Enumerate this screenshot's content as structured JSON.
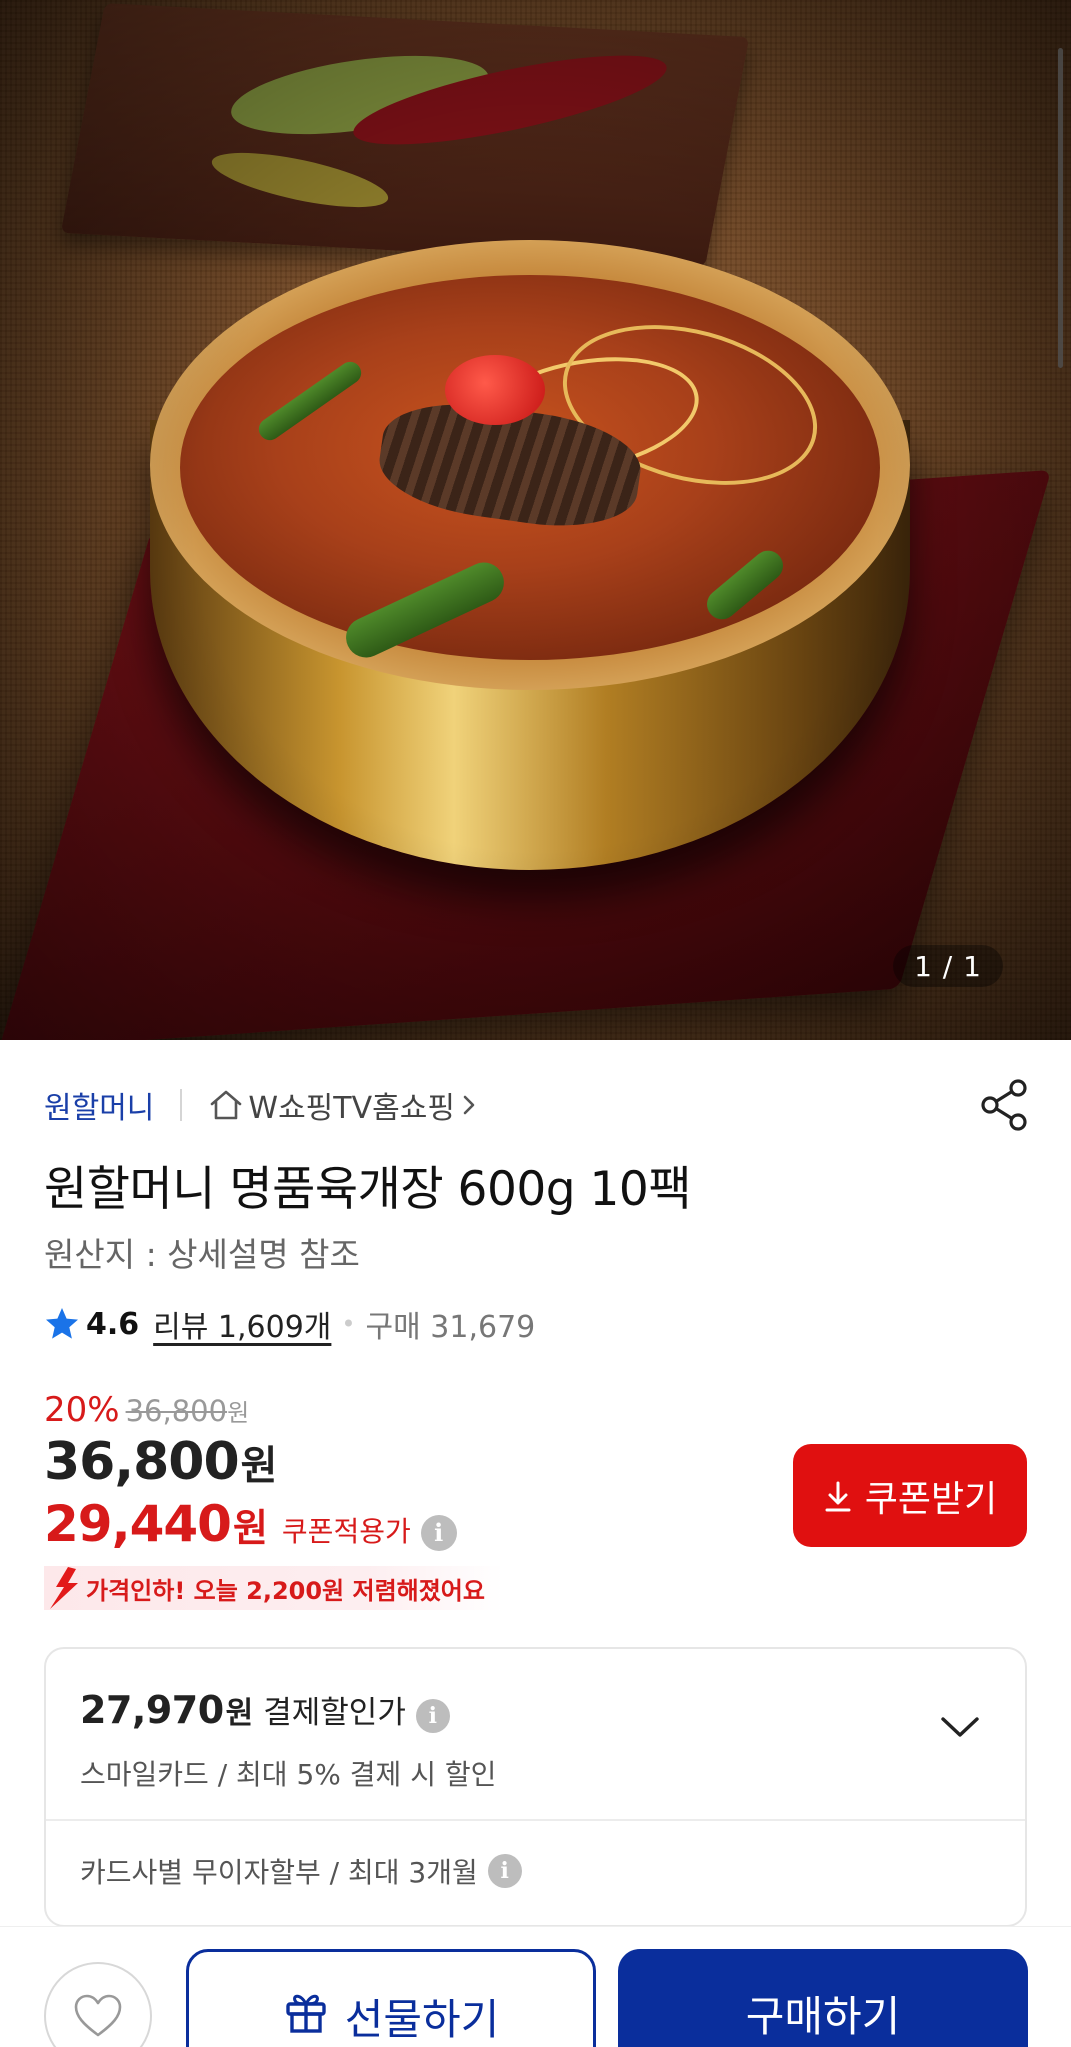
{
  "gallery": {
    "counter": "1 / 1",
    "image_alt": "육개장 in brass bowl"
  },
  "store": {
    "brand": "원할머니",
    "channel": "W쇼핑TV홈쇼핑"
  },
  "product": {
    "title": "원할머니 명품육개장 600g 10팩",
    "origin": "원산지 : 상세설명 참조",
    "rating": "4.6",
    "review_link": "리뷰 1,609개",
    "purchase_count": "구매 31,679"
  },
  "pricing": {
    "discount_rate": "20%",
    "original_price": "36,800",
    "original_unit": "원",
    "sale_price": "36,800",
    "sale_unit": "원",
    "coupon_price": "29,440",
    "coupon_unit": "원",
    "coupon_label": "쿠폰적용가",
    "coupon_button": "쿠폰받기",
    "price_drop_text": "가격인하! 오늘 2,200원 저렴해졌어요"
  },
  "payment": {
    "pay_price": "27,970",
    "pay_unit": "원",
    "pay_label": "결제할인가",
    "pay_detail": "스마일카드 / 최대 5% 결제 시 할인",
    "installment": "카드사별 무이자할부 / 최대 3개월"
  },
  "actions": {
    "gift": "선물하기",
    "buy": "구매하기"
  },
  "colors": {
    "brand_blue": "#0a2e9c",
    "accent_red": "#e01010"
  }
}
